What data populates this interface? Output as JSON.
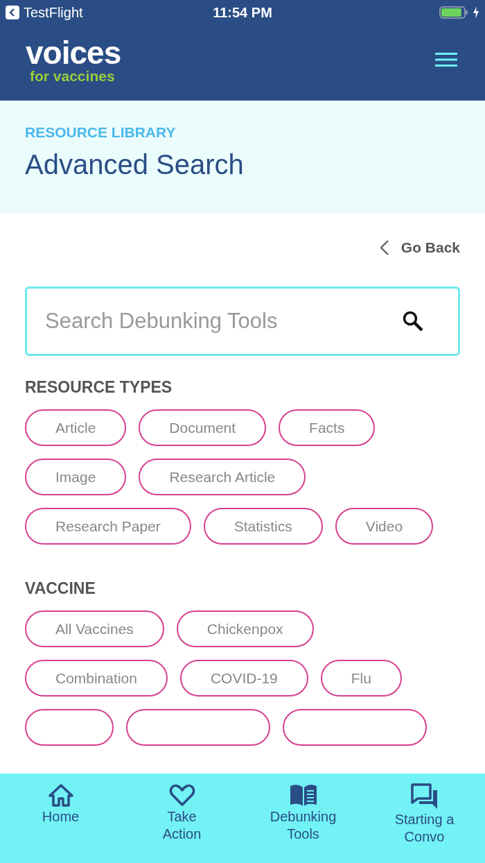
{
  "status_bar": {
    "back_app": "TestFlight",
    "time": "11:54 PM",
    "battery": {
      "level": 0.9
    }
  },
  "header": {
    "logo_title": "voices",
    "logo_subtitle": "for vaccines"
  },
  "hero": {
    "eyebrow": "RESOURCE LIBRARY",
    "title": "Advanced Search"
  },
  "go_back": "Go Back",
  "search": {
    "placeholder": "Search Debunking Tools"
  },
  "sections": [
    {
      "title": "RESOURCE TYPES",
      "chips": [
        {
          "kind": "chip",
          "label": "Article"
        },
        {
          "kind": "chip",
          "label": "Document"
        },
        {
          "kind": "chip",
          "label": "Facts"
        },
        {
          "kind": "chip",
          "label": "Image"
        },
        {
          "kind": "chip",
          "label": "Research Article"
        },
        {
          "kind": "chip",
          "label": "Research Paper"
        },
        {
          "kind": "chip",
          "label": "Statistics"
        },
        {
          "kind": "chip",
          "label": "Video"
        }
      ]
    },
    {
      "title": "VACCINE",
      "chips": [
        {
          "kind": "chip",
          "label": "All Vaccines"
        },
        {
          "kind": "chip",
          "label": "Chickenpox"
        },
        {
          "kind": "chip",
          "label": "Combination"
        },
        {
          "kind": "chip",
          "label": "COVID-19"
        },
        {
          "kind": "chip",
          "label": "Flu"
        },
        {
          "kind": "cut"
        },
        {
          "kind": "cut"
        },
        {
          "kind": "cut"
        }
      ]
    }
  ],
  "nav": [
    {
      "kind": "home",
      "label": "Home"
    },
    {
      "kind": "heart",
      "label": "Take Action"
    },
    {
      "kind": "book",
      "label": "Debunking Tools"
    },
    {
      "kind": "chat",
      "label": "Starting a Convo"
    }
  ]
}
